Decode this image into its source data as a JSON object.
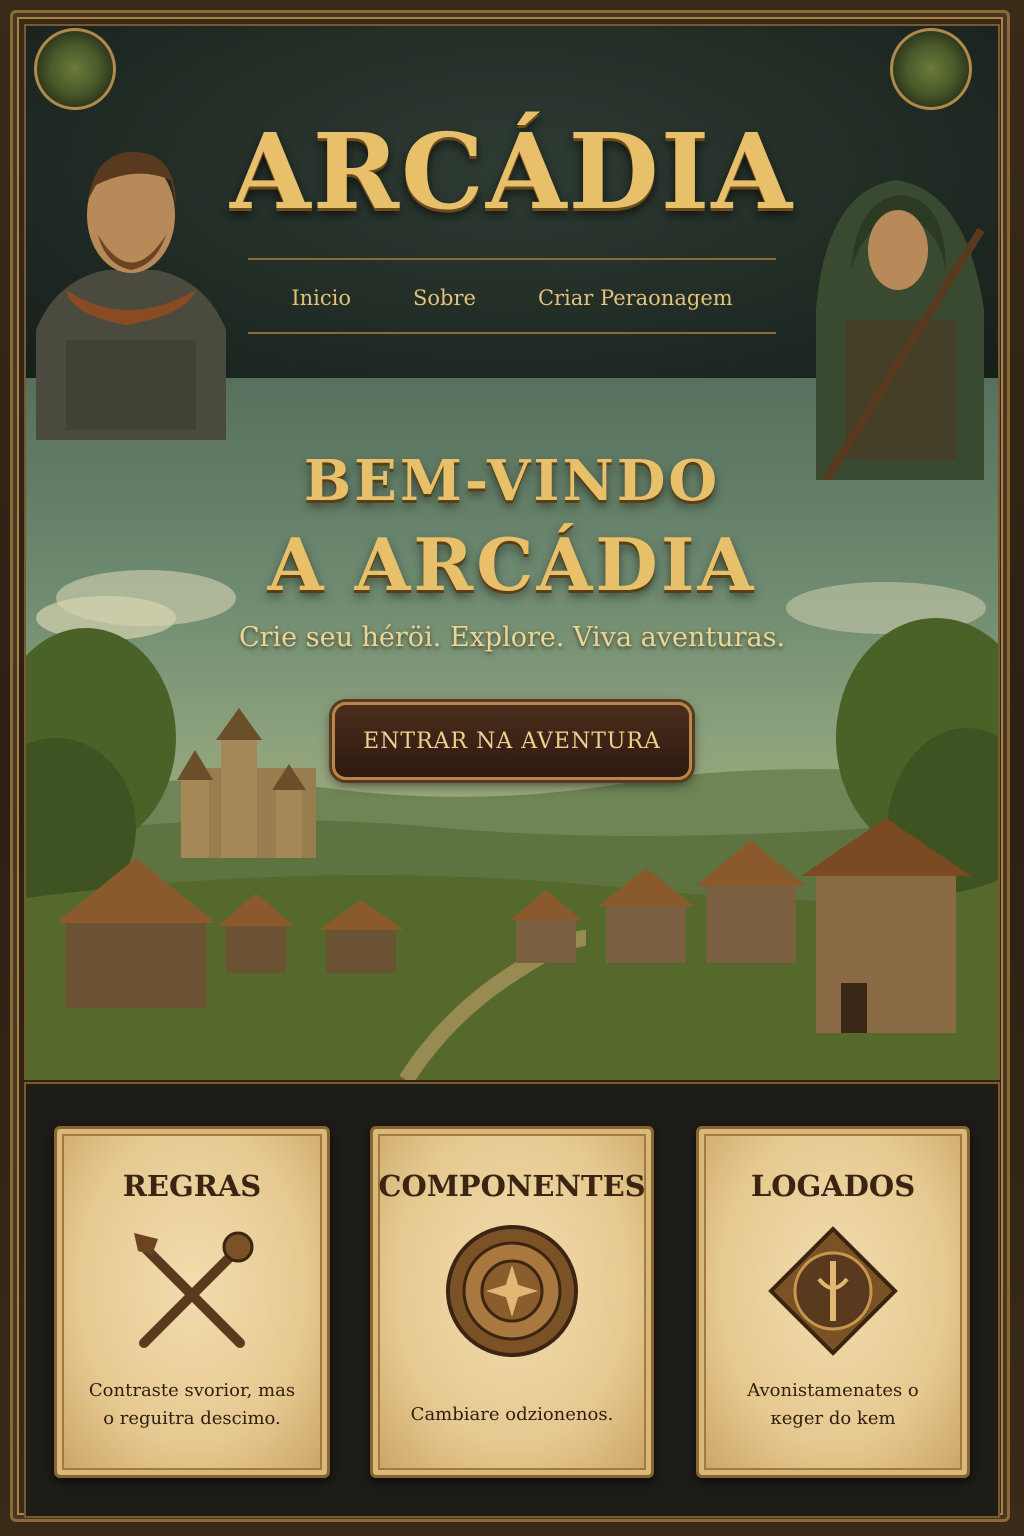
{
  "header": {
    "title": "ARCÁDIA",
    "nav": [
      "Inicio",
      "Sobre",
      "Criar Peraonagem"
    ]
  },
  "hero": {
    "title_line1": "BEM-VINDO",
    "title_line2": "A ARCÁDIA",
    "subtitle": "Crie seu héröi. Explore. Viva aventuras.",
    "cta_label": "ENTRAR NA AVENTURA"
  },
  "cards": [
    {
      "title": "REGRAS",
      "description": "Contraste svorior, mas o reguitra descimo.",
      "icon": "crossed-maces-icon"
    },
    {
      "title": "COMPONENTES",
      "description": "Cambiare odzionenos.",
      "icon": "compass-medallion-icon"
    },
    {
      "title": "LOGADOS",
      "description": "Avonistamenates o кeger do kem",
      "icon": "rune-shield-icon"
    }
  ],
  "colors": {
    "gold": "#e8c06a",
    "parchment": "#e6c990",
    "frame": "#8a6a35",
    "dark_green": "#1e2822"
  }
}
